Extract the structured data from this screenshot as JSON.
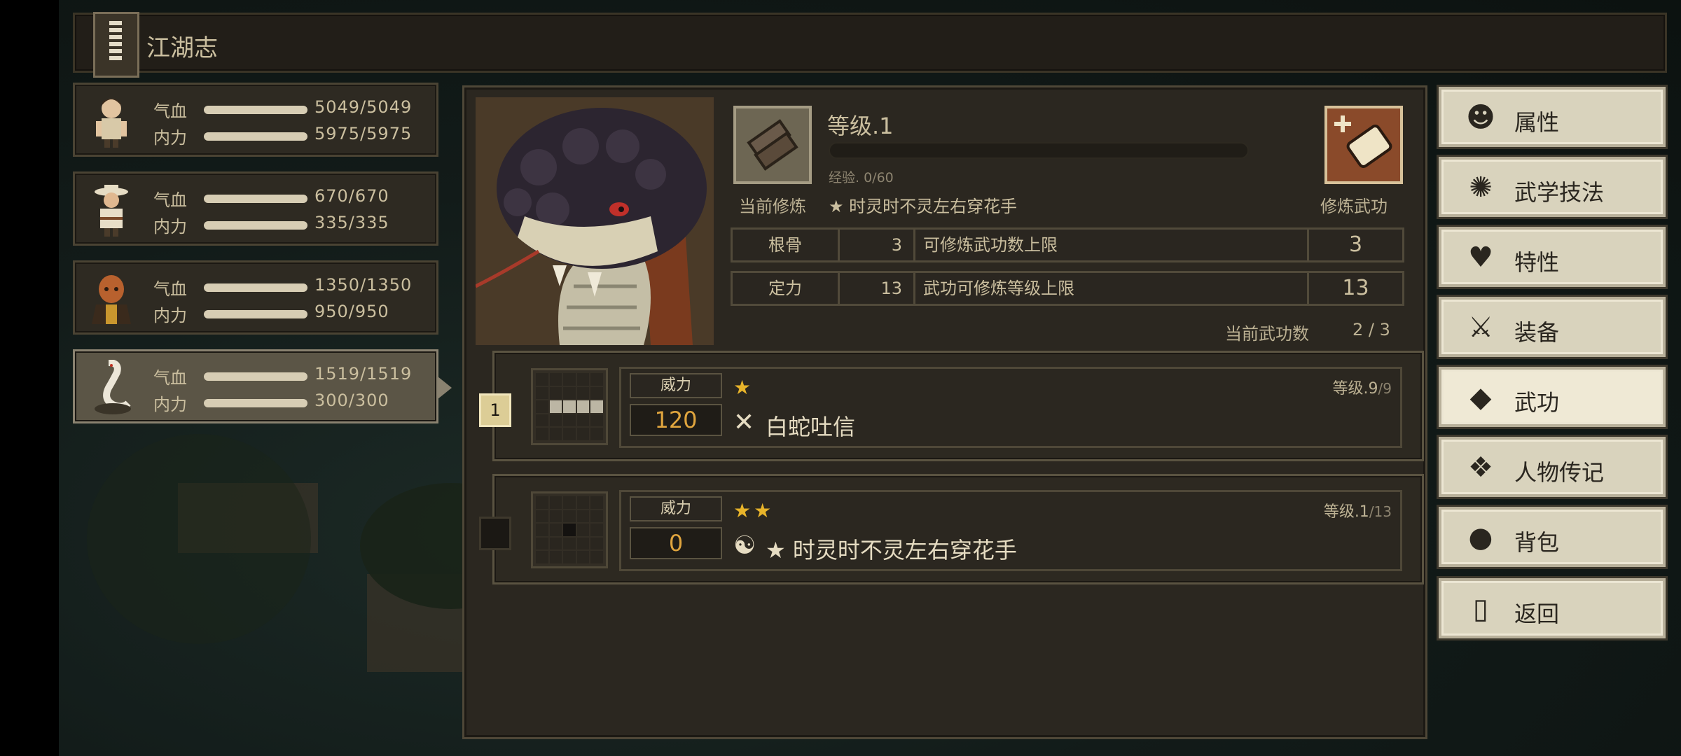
{
  "header": {
    "title": "江湖志"
  },
  "party": [
    {
      "hp_label": "气血",
      "hp": "5049/5049",
      "mp_label": "内力",
      "mp": "5975/5975"
    },
    {
      "hp_label": "气血",
      "hp": "670/670",
      "mp_label": "内力",
      "mp": "335/335"
    },
    {
      "hp_label": "气血",
      "hp": "1350/1350",
      "mp_label": "内力",
      "mp": "950/950"
    },
    {
      "hp_label": "气血",
      "hp": "1519/1519",
      "mp_label": "内力",
      "mp": "300/300"
    }
  ],
  "cultivation": {
    "level": "等级.1",
    "exp": "经验. 0/60",
    "exp_fraction": 0,
    "current_label": "当前修炼",
    "current_value": "★ 时灵时不灵左右穿花手",
    "train_label": "修炼武功"
  },
  "stats": [
    {
      "name": "根骨",
      "value": "3",
      "desc": "可修炼武功数上限",
      "cap": "3"
    },
    {
      "name": "定力",
      "value": "13",
      "desc": "武功可修炼等级上限",
      "cap": "13"
    }
  ],
  "count": {
    "label": "当前武功数",
    "value": "2 / 3"
  },
  "skills": [
    {
      "slot": "1",
      "power_label": "威力",
      "power": "120",
      "stars": "★",
      "type_icon": "✕",
      "name": "白蛇吐信",
      "level": "等级.9",
      "level_max": "/9"
    },
    {
      "slot": "",
      "power_label": "威力",
      "power": "0",
      "stars": "★★",
      "type_icon": "☯",
      "name": "★ 时灵时不灵左右穿花手",
      "level": "等级.1",
      "level_max": "/13"
    }
  ],
  "menu": [
    {
      "label": "属性",
      "icon": "person-icon"
    },
    {
      "label": "武学技法",
      "icon": "sparkle-person-icon"
    },
    {
      "label": "特性",
      "icon": "heart-person-icon"
    },
    {
      "label": "装备",
      "icon": "sword-icon"
    },
    {
      "label": "武功",
      "icon": "book-icon"
    },
    {
      "label": "人物传记",
      "icon": "scroll-icon"
    },
    {
      "label": "背包",
      "icon": "bag-icon"
    },
    {
      "label": "返回",
      "icon": "door-icon"
    }
  ],
  "colors": {
    "power": "#e0a53e",
    "star": "#e8b42a",
    "menu_bg": "#d9d3bd",
    "panel": "#2b2720"
  }
}
